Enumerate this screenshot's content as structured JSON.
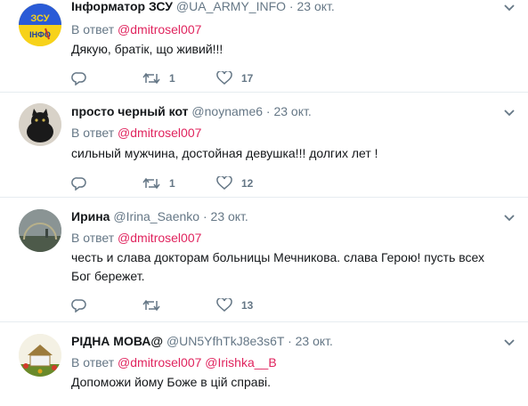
{
  "tweets": [
    {
      "name": "Інформатор ЗСУ",
      "handle": "@UA_ARMY_INFO",
      "dot": "·",
      "time": "23 окт.",
      "reply_prefix": "В ответ",
      "mentions": [
        "@dmitrosel007"
      ],
      "text": "Дякую, братік, що живий!!!",
      "retweets": "1",
      "likes": "17",
      "avatar_label": "ЗСУ ІНФО"
    },
    {
      "name": "просто черный кот",
      "handle": "@noyname6",
      "dot": "·",
      "time": "23 окт.",
      "reply_prefix": "В ответ",
      "mentions": [
        "@dmitrosel007"
      ],
      "text": "сильный мужчина, достойная девушка!!! долгих лет !",
      "retweets": "1",
      "likes": "12"
    },
    {
      "name": "Ирина",
      "handle": "@Irina_Saenko",
      "dot": "·",
      "time": "23 окт.",
      "reply_prefix": "В ответ",
      "mentions": [
        "@dmitrosel007"
      ],
      "text": "честь и слава докторам больницы Мечникова. слава Герою! пусть всех Бог бережет.",
      "retweets": "",
      "likes": "13"
    },
    {
      "name": "РІДНА МОВА@",
      "handle": "@UN5YfhTkJ8e3s6T",
      "dot": "·",
      "time": "23 окт.",
      "reply_prefix": "В ответ",
      "mentions": [
        "@dmitrosel007",
        "@Irishka__B"
      ],
      "text": "Допоможи йому Боже в цій справі."
    }
  ],
  "icons": {
    "reply": "reply-icon",
    "retweet": "retweet-icon",
    "like": "heart-icon",
    "menu": "chevron-down-icon"
  },
  "colors": {
    "mention": "#e0245e",
    "muted": "#657786",
    "divider": "#e6ecf0"
  }
}
